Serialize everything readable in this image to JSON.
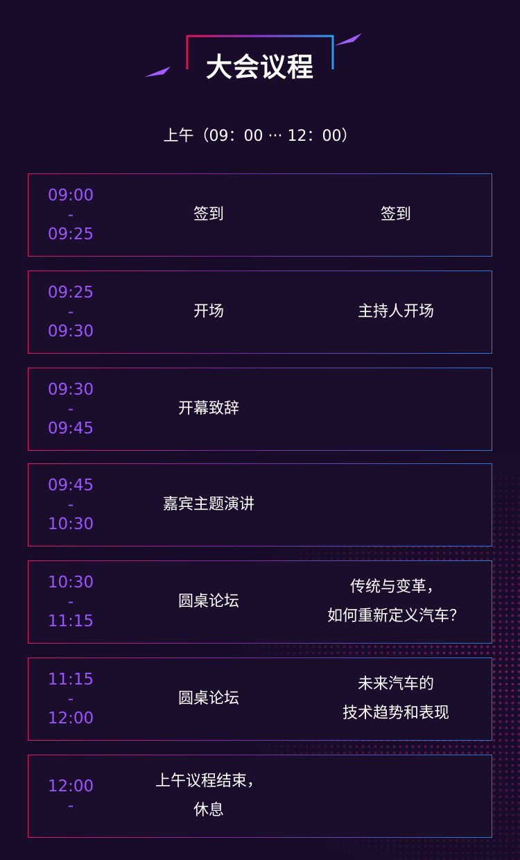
{
  "header": {
    "title": "大会议程",
    "subtitle": "上午（09：00 ··· 12：00）"
  },
  "colors": {
    "background": "#190c2a",
    "accent_purple": "#9a55ff",
    "border_pink": "#d81a5c",
    "border_blue": "#2a7bd6"
  },
  "agenda": [
    {
      "start": "09:00",
      "sep": "-",
      "end": "09:25",
      "session": [
        "签到"
      ],
      "topic": [
        "签到"
      ]
    },
    {
      "start": "09:25",
      "sep": "-",
      "end": "09:30",
      "session": [
        "开场"
      ],
      "topic": [
        "主持人开场"
      ]
    },
    {
      "start": "09:30",
      "sep": "-",
      "end": "09:45",
      "session": [
        "开幕致辞"
      ],
      "topic": []
    },
    {
      "start": "09:45",
      "sep": "-",
      "end": "10:30",
      "session": [
        "嘉宾主题演讲"
      ],
      "topic": []
    },
    {
      "start": "10:30",
      "sep": "-",
      "end": "11:15",
      "session": [
        "圆桌论坛"
      ],
      "topic": [
        "传统与变革，",
        "如何重新定义汽车？"
      ]
    },
    {
      "start": "11:15",
      "sep": "-",
      "end": "12:00",
      "session": [
        "圆桌论坛"
      ],
      "topic": [
        "未来汽车的",
        "技术趋势和表现"
      ]
    },
    {
      "start": "12:00",
      "sep": "-",
      "end": "",
      "session": [
        "上午议程结束，",
        "休息"
      ],
      "topic": []
    }
  ]
}
